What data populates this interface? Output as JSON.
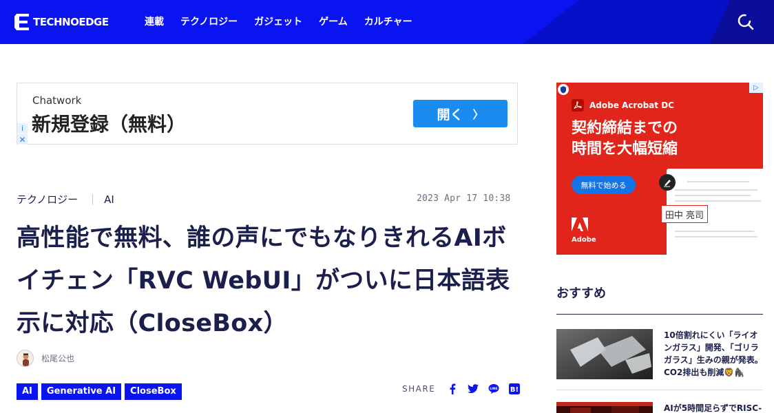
{
  "site": {
    "logo_text": "TECHNOEDGE"
  },
  "nav": {
    "items": [
      "連載",
      "テクノロジー",
      "ガジェット",
      "ゲーム",
      "カルチャー"
    ]
  },
  "ad_banner": {
    "brand": "Chatwork",
    "headline": "新規登録（無料）",
    "cta": "開く",
    "cta_arrow": "〉"
  },
  "article": {
    "category": "テクノロジー",
    "subcategory": "AI",
    "date": "2023 Apr 17 10:38",
    "title": "高性能で無料、誰の声にでもなりきれるAIボイチェン「RVC WebUI」がついに日本語表示に対応（CloseBox）",
    "author": "松尾公也",
    "tags": [
      "AI",
      "Generative AI",
      "CloseBox"
    ],
    "share_label": "SHARE"
  },
  "side_ad": {
    "brand": "Adobe Acrobat DC",
    "headline_line1": "契約締結までの",
    "headline_line2": "時間を大幅短縮",
    "cta": "無料で始める",
    "adobe_label": "Adobe",
    "signature": "田中 亮司"
  },
  "recommend": {
    "heading": "おすすめ",
    "items": [
      {
        "title": "10倍割れにくい「ライオンガラス」開発、「ゴリラガラス」生みの親が発表。CO2排出も削減🦁🦍"
      },
      {
        "title": "AIが5時間足らずでRISC-"
      }
    ]
  },
  "colors": {
    "brand_blue": "#0a14f0",
    "text_navy": "#1a1f4b",
    "adobe_red": "#e1251b",
    "chatwork_blue": "#1a8cf0"
  }
}
